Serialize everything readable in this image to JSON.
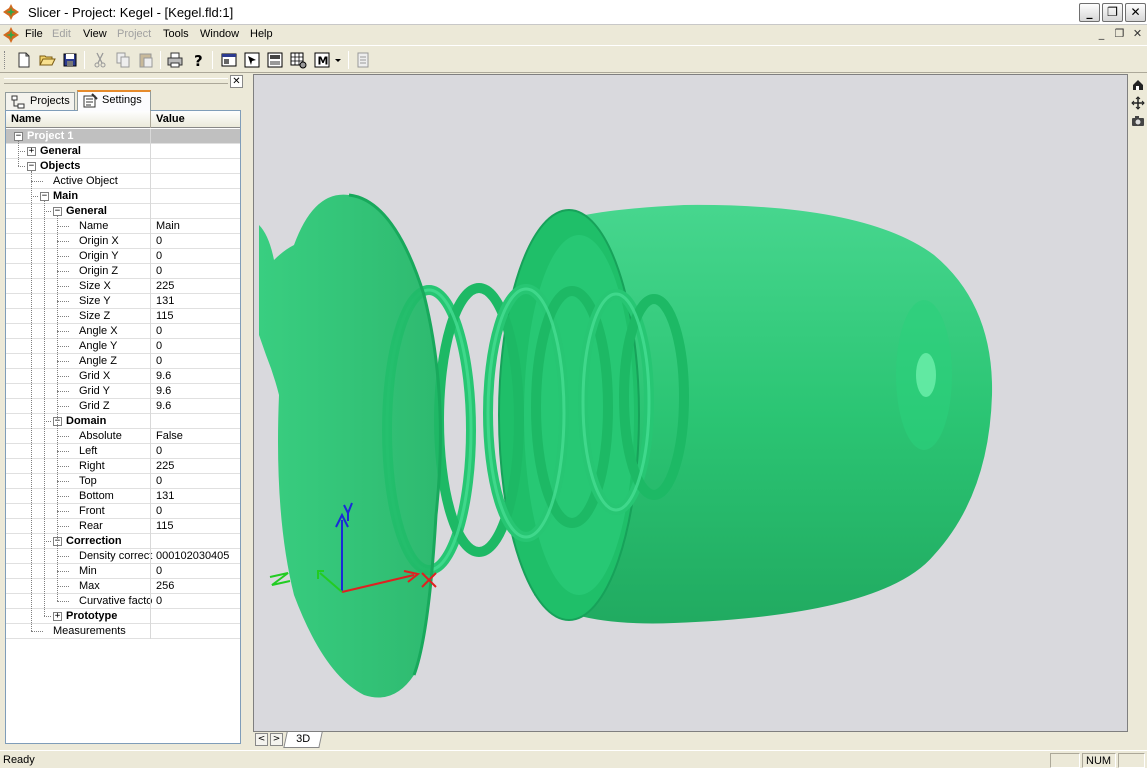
{
  "window": {
    "title": "Slicer - Project: Kegel  - [Kegel.fld:1]",
    "minimize_symbol": "_",
    "restore_symbol": "❐",
    "close_symbol": "✕"
  },
  "menu": {
    "items": [
      {
        "label": "File",
        "enabled": true
      },
      {
        "label": "Edit",
        "enabled": false
      },
      {
        "label": "View",
        "enabled": true
      },
      {
        "label": "Project",
        "enabled": false
      },
      {
        "label": "Tools",
        "enabled": true
      },
      {
        "label": "Window",
        "enabled": true
      },
      {
        "label": "Help",
        "enabled": true
      }
    ],
    "mdi_minimize": "_",
    "mdi_restore": "❐",
    "mdi_close": "✕"
  },
  "toolbar": {
    "buttons": [
      "new-file-icon",
      "open-folder-icon",
      "save-icon",
      "cut-icon",
      "copy-icon",
      "paste-icon",
      "print-icon",
      "help-icon",
      "view-window-icon",
      "select-pointer-icon",
      "slice-view-icon",
      "grid-settings-icon",
      "mode-m-icon",
      "export-icon"
    ],
    "mode_label": "M"
  },
  "panel": {
    "close_symbol": "✕",
    "tabs": [
      {
        "label": "Projects",
        "active": false
      },
      {
        "label": "Settings",
        "active": true
      }
    ],
    "columns": {
      "name": "Name",
      "value": "Value"
    }
  },
  "tree": {
    "rows": [
      {
        "label": "Project 1",
        "value": "",
        "level": 0,
        "expander": "minus",
        "bold": true,
        "selected": true
      },
      {
        "label": "General",
        "value": "",
        "level": 1,
        "expander": "plus",
        "bold": true
      },
      {
        "label": "Objects",
        "value": "",
        "level": 1,
        "expander": "minus",
        "bold": true
      },
      {
        "label": "Active Object",
        "value": "",
        "level": 2,
        "expander": "",
        "bold": false
      },
      {
        "label": "Main",
        "value": "",
        "level": 2,
        "expander": "minus",
        "bold": true
      },
      {
        "label": "General",
        "value": "",
        "level": 3,
        "expander": "minus",
        "bold": true
      },
      {
        "label": "Name",
        "value": "Main",
        "level": 4,
        "expander": "",
        "bold": false
      },
      {
        "label": "Origin X",
        "value": "0",
        "level": 4,
        "expander": "",
        "bold": false
      },
      {
        "label": "Origin Y",
        "value": "0",
        "level": 4,
        "expander": "",
        "bold": false
      },
      {
        "label": "Origin Z",
        "value": "0",
        "level": 4,
        "expander": "",
        "bold": false
      },
      {
        "label": "Size X",
        "value": "225",
        "level": 4,
        "expander": "",
        "bold": false
      },
      {
        "label": "Size Y",
        "value": "131",
        "level": 4,
        "expander": "",
        "bold": false
      },
      {
        "label": "Size Z",
        "value": "115",
        "level": 4,
        "expander": "",
        "bold": false
      },
      {
        "label": "Angle X",
        "value": "0",
        "level": 4,
        "expander": "",
        "bold": false
      },
      {
        "label": "Angle Y",
        "value": "0",
        "level": 4,
        "expander": "",
        "bold": false
      },
      {
        "label": "Angle Z",
        "value": "0",
        "level": 4,
        "expander": "",
        "bold": false
      },
      {
        "label": "Grid X",
        "value": "9.6",
        "level": 4,
        "expander": "",
        "bold": false
      },
      {
        "label": "Grid Y",
        "value": "9.6",
        "level": 4,
        "expander": "",
        "bold": false
      },
      {
        "label": "Grid Z",
        "value": "9.6",
        "level": 4,
        "expander": "",
        "bold": false
      },
      {
        "label": "Domain",
        "value": "",
        "level": 3,
        "expander": "minus",
        "bold": true
      },
      {
        "label": "Absolute",
        "value": "False",
        "level": 4,
        "expander": "",
        "bold": false
      },
      {
        "label": "Left",
        "value": "0",
        "level": 4,
        "expander": "",
        "bold": false
      },
      {
        "label": "Right",
        "value": "225",
        "level": 4,
        "expander": "",
        "bold": false
      },
      {
        "label": "Top",
        "value": "0",
        "level": 4,
        "expander": "",
        "bold": false
      },
      {
        "label": "Bottom",
        "value": "131",
        "level": 4,
        "expander": "",
        "bold": false
      },
      {
        "label": "Front",
        "value": "0",
        "level": 4,
        "expander": "",
        "bold": false
      },
      {
        "label": "Rear",
        "value": "115",
        "level": 4,
        "expander": "",
        "bold": false
      },
      {
        "label": "Correction",
        "value": "",
        "level": 3,
        "expander": "minus",
        "bold": true
      },
      {
        "label": "Density correct",
        "value": "000102030405",
        "level": 4,
        "expander": "",
        "bold": false
      },
      {
        "label": "Min",
        "value": "0",
        "level": 4,
        "expander": "",
        "bold": false
      },
      {
        "label": "Max",
        "value": "256",
        "level": 4,
        "expander": "",
        "bold": false
      },
      {
        "label": "Curvative facto",
        "value": "0",
        "level": 4,
        "expander": "",
        "bold": false
      },
      {
        "label": "Prototype",
        "value": "",
        "level": 3,
        "expander": "plus",
        "bold": true
      },
      {
        "label": "Measurements",
        "value": "",
        "level": 2,
        "expander": "",
        "bold": false
      }
    ]
  },
  "viewport": {
    "background": "#d9d9dd",
    "model_color": "#22c46e",
    "axes": {
      "x_color": "#e02020",
      "y_color": "#1a2ad8",
      "z_color": "#22cc22",
      "x_label": "X",
      "y_label": "Y",
      "z_label": "Z"
    },
    "side_icons": [
      "home-icon",
      "pan-icon",
      "camera-icon"
    ]
  },
  "bottom_tabs": {
    "prev": "<",
    "next": ">",
    "tabs": [
      "3D"
    ]
  },
  "status": {
    "text": "Ready",
    "num": "NUM"
  }
}
